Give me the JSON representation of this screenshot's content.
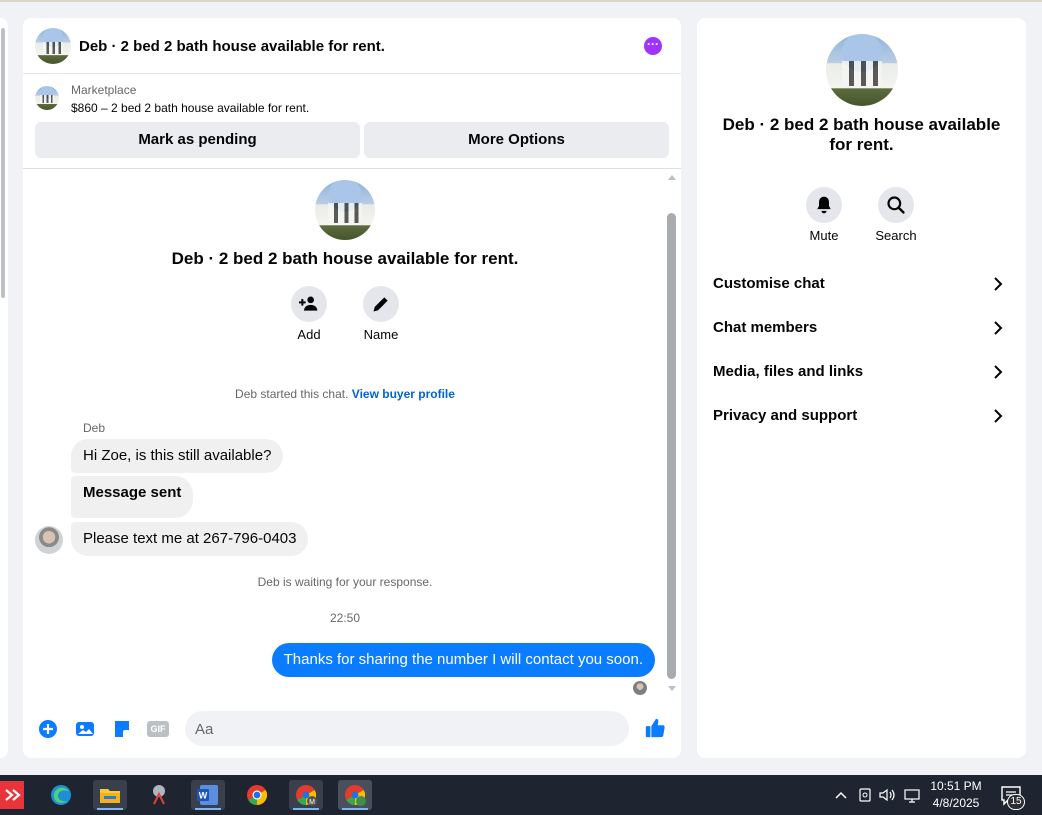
{
  "chat": {
    "title": "Deb · 2 bed 2 bath house available for rent.",
    "more_glyph": "···",
    "marketplace_label": "Marketplace",
    "listing_line": "$860 – 2 bed 2 bath house available for rent.",
    "mark_pending": "Mark as pending",
    "more_options": "More Options"
  },
  "intro": {
    "title": "Deb · 2 bed 2 bath house available for rent.",
    "add_label": "Add",
    "name_label": "Name",
    "started_text": "Deb started this chat.",
    "buyer_profile_link": "View buyer profile"
  },
  "messages": {
    "sender": "Deb",
    "m1": "Hi Zoe, is this still available?",
    "m2": "Message sent",
    "m3": "Please text me at 267-796-0403",
    "waiting": "Deb is waiting for your response.",
    "timestamp": "22:50",
    "my_message": "Thanks for sharing the number I will contact you soon."
  },
  "composer": {
    "placeholder": "Aa",
    "gif_label": "GIF"
  },
  "info_panel": {
    "title": "Deb · 2 bed 2 bath house available for rent.",
    "mute": "Mute",
    "search": "Search",
    "menu": [
      {
        "label": "Customise chat"
      },
      {
        "label": "Chat members"
      },
      {
        "label": "Media, files and links"
      },
      {
        "label": "Privacy and support"
      }
    ]
  },
  "taskbar": {
    "time": "10:51 PM",
    "date": "4/8/2025",
    "notifications": "15",
    "word_glyph": "W",
    "chrome_profile_letter": "M"
  },
  "colors": {
    "accent_blue": "#0a7cff",
    "purple": "#a033ff",
    "link_blue": "#0064d1"
  }
}
